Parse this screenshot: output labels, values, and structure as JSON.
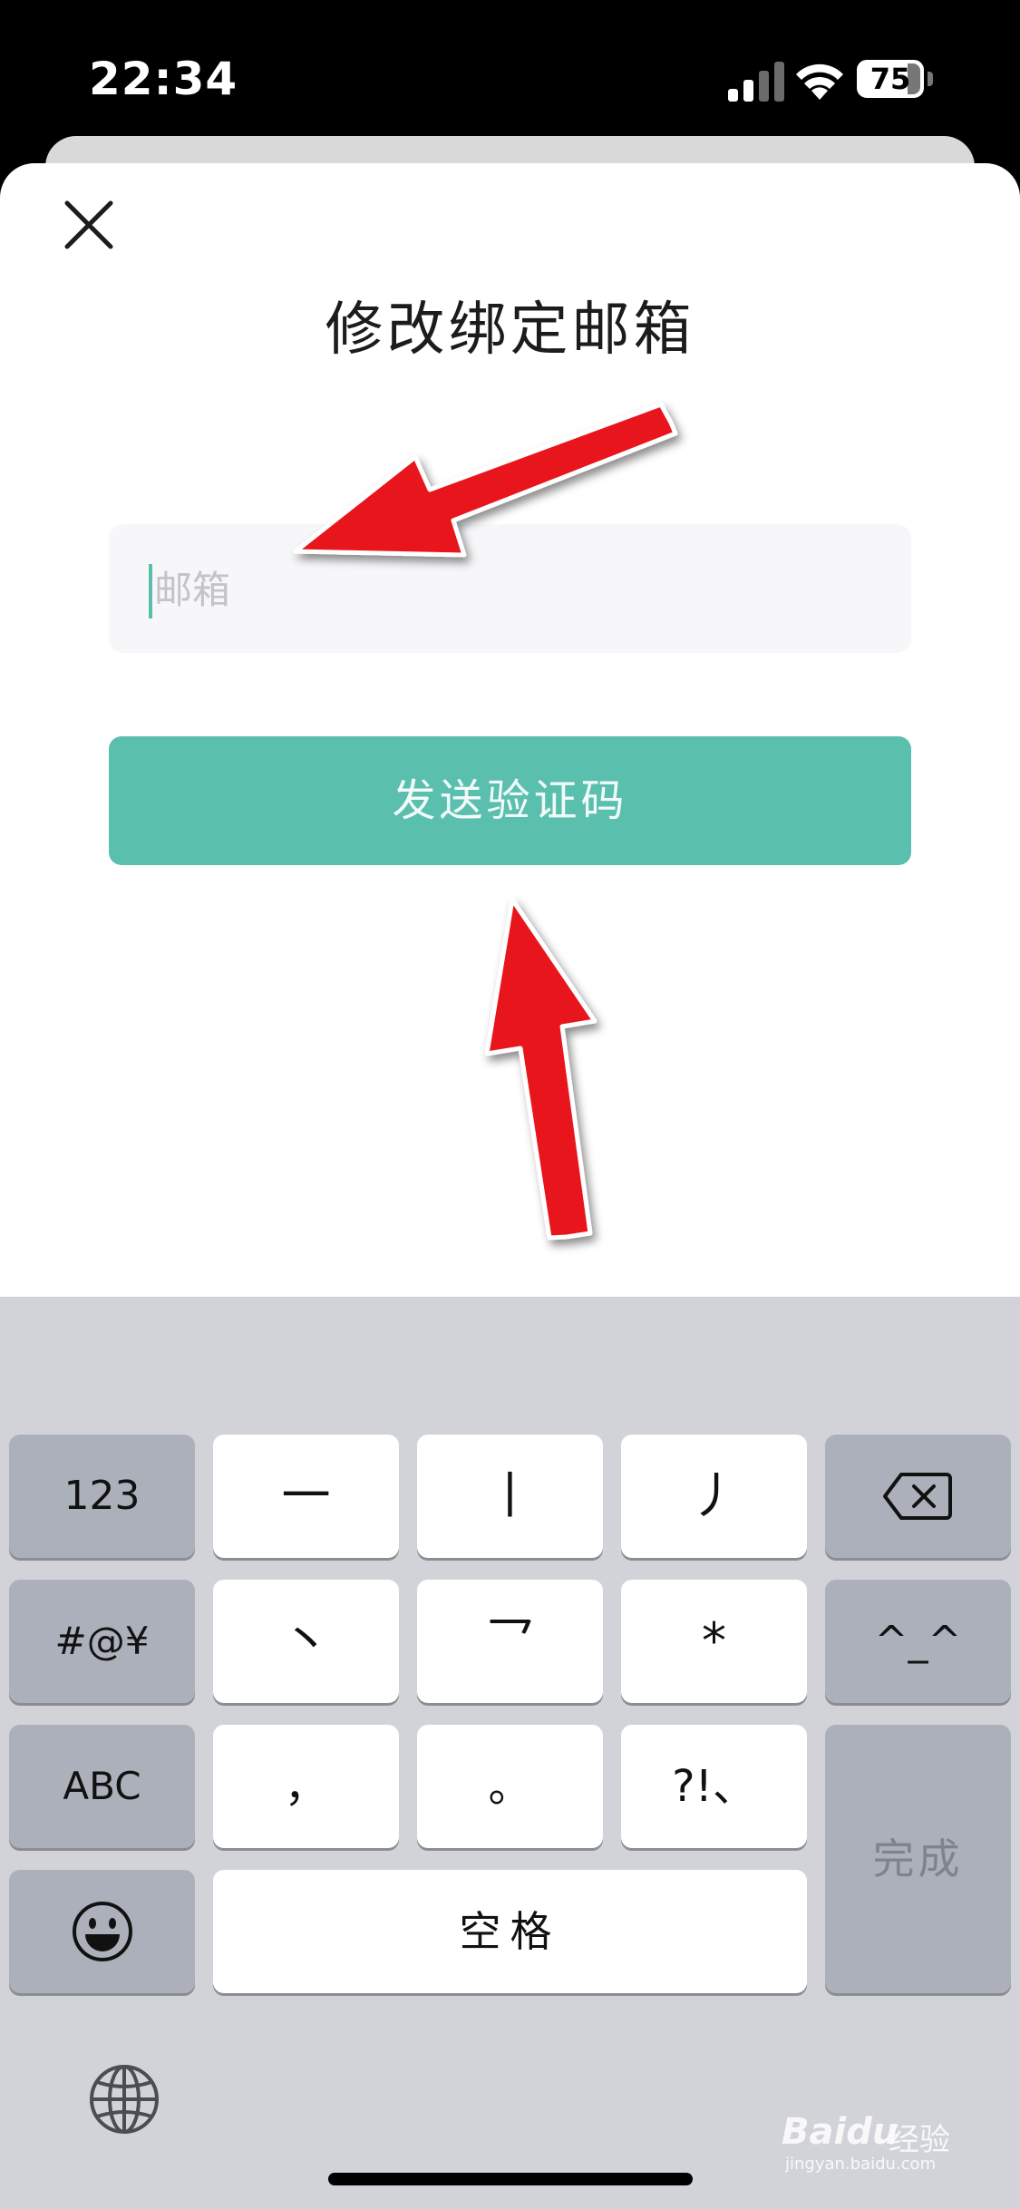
{
  "status_bar": {
    "time": "22:34",
    "battery": "75"
  },
  "sheet": {
    "title": "修改绑定邮箱"
  },
  "email_field": {
    "placeholder": "邮箱",
    "value": ""
  },
  "send_button": {
    "label": "发送验证码"
  },
  "keyboard": {
    "key_123": "123",
    "key_heng": "一",
    "key_shu": "丨",
    "key_pie": "丿",
    "key_symbols": "#@¥",
    "key_dian": "丶",
    "key_zhe": "乛",
    "key_star": "*",
    "key_emoticon": "^_^",
    "key_abc": "ABC",
    "key_comma": "，",
    "key_period": "。",
    "key_punct": "?!、",
    "key_done": "完成",
    "key_space": "空格"
  },
  "watermark": {
    "text_logo": "Baidu",
    "text_cn": "经验",
    "url": "jingyan.baidu.com"
  },
  "colors": {
    "accent": "#5bbfae",
    "arrow": "#e8141a"
  }
}
